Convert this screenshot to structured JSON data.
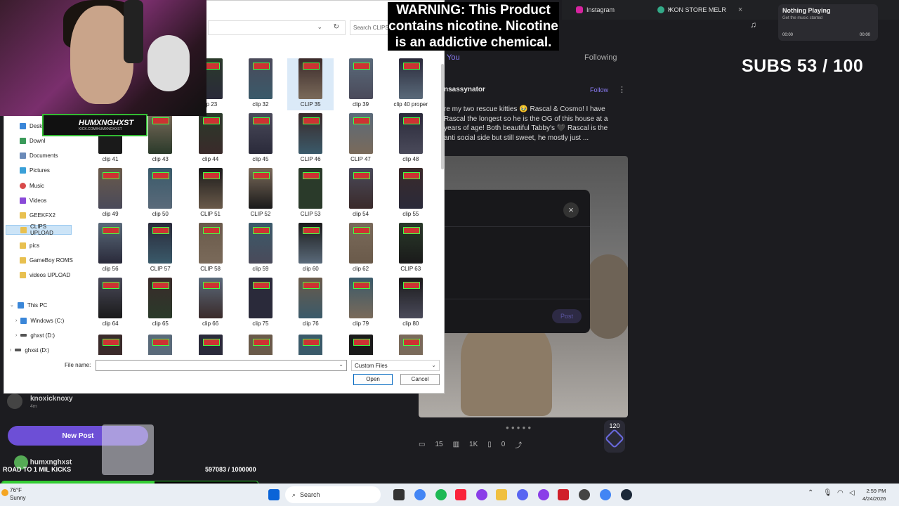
{
  "browser_tabs": [
    "Instagram",
    "IKON STORE MELR"
  ],
  "music": {
    "title": "Nothing Playing",
    "subtitle": "Get the music started",
    "time_start": "00:00",
    "time_end": "00:00"
  },
  "subs_counter": "SUBS 53 / 100",
  "warning": "WARNING: This Product contains nicotine. Nicotine is an addictive chemical.",
  "feed": {
    "tab_you": "You",
    "tab_following": "Following"
  },
  "post": {
    "author": "nsassynator",
    "follow": "Follow",
    "body": "re my two rescue kitties 🥹 Rascal & Cosmo! I have Rascal the longest so he is the OG of this house at a years of age! Both beautiful Tabby's 🖤 Rascal is the anti social side but still sweet, he mostly just ...",
    "modal_post_button": "Post",
    "comments": "15",
    "views": "1K",
    "saves": "0",
    "badge_count": "120"
  },
  "sidebar_bottom": {
    "user": "knoxicknoxy",
    "user_time": "4m",
    "new_post": "New Post",
    "me": "humxnghxst"
  },
  "stream_goal": {
    "label": "ROAD TO 1 MIL KICKS",
    "count": "597083 / 1000000",
    "progress": 0.597
  },
  "brand_overlay": {
    "name": "HUMXNGHXST",
    "sub": "KICK.COM/HUMXNGHXST"
  },
  "dialog": {
    "search_placeholder": "Search CLIPS U",
    "nav": [
      "Deskt",
      "Downl",
      "Documents",
      "Pictures",
      "Music",
      "Videos",
      "GEEKFX2",
      "CLIPS UPLOAD",
      "pics",
      "GameBoy ROMS",
      "videos UPLOAD",
      "This PC",
      "Windows (C:)",
      "ghxst (D:)",
      "ghxst (D:)"
    ],
    "files": [
      [
        "lip 23",
        "clip 32",
        "CLIP 35",
        "clip 39",
        "clip 40 proper"
      ],
      [
        "clip 41",
        "clip 43",
        "clip 44",
        "clip 45",
        "CLIP 46",
        "CLIP 47",
        "clip 48"
      ],
      [
        "clip 49",
        "clip 50",
        "CLIP 51",
        "CLIP 52",
        "CLIP 53",
        "clip 54",
        "clip 55"
      ],
      [
        "clip 56",
        "CLIP 57",
        "CLIP 58",
        "clip 59",
        "clip 60",
        "clip 62",
        "CLIP 63"
      ],
      [
        "clip 64",
        "clip 65",
        "clip 66",
        "clip 75",
        "clip 76",
        "clip 79",
        "clip 80"
      ]
    ],
    "file_name_label": "File name:",
    "file_type": "Custom Files",
    "open": "Open",
    "cancel": "Cancel"
  },
  "taskbar": {
    "temp": "76°F",
    "condition": "Sunny",
    "search": "Search",
    "time": "2:59 PM",
    "date": "4/24/2026"
  }
}
